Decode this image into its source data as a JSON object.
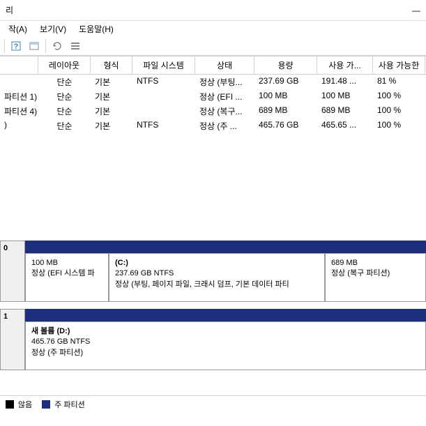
{
  "window": {
    "title": "리"
  },
  "menu": {
    "action": "작(A)",
    "view": "보기(V)",
    "help": "도움말(H)"
  },
  "columns": {
    "name": "",
    "layout": "레이아웃",
    "type": "형식",
    "fs": "파일 시스템",
    "state": "상태",
    "capacity": "용량",
    "used": "사용 가...",
    "free": "사용 가능한"
  },
  "rows": [
    {
      "name": "",
      "layout": "단순",
      "type": "기본",
      "fs": "NTFS",
      "state": "정상 (부팅...",
      "cap": "237.69 GB",
      "used": "191.48 ...",
      "free": "81 %"
    },
    {
      "name": "파티션 1)",
      "layout": "단순",
      "type": "기본",
      "fs": "",
      "state": "정상 (EFI ...",
      "cap": "100 MB",
      "used": "100 MB",
      "free": "100 %"
    },
    {
      "name": "파티션 4)",
      "layout": "단순",
      "type": "기본",
      "fs": "",
      "state": "정상 (복구...",
      "cap": "689 MB",
      "used": "689 MB",
      "free": "100 %"
    },
    {
      "name": ")",
      "layout": "단순",
      "type": "기본",
      "fs": "NTFS",
      "state": "정상 (주 ...",
      "cap": "465.76 GB",
      "used": "465.65 ...",
      "free": "100 %"
    }
  ],
  "disk0": {
    "label": "0",
    "p1": {
      "size": "100 MB",
      "desc": "정상 (EFI 시스템 파"
    },
    "p2": {
      "name": "(C:)",
      "size": "237.69 GB NTFS",
      "desc": "정상 (부팅, 페이지 파일, 크래시 덤프, 기본 데이터 파티"
    },
    "p3": {
      "size": "689 MB",
      "desc": "정상 (복구 파티션)"
    }
  },
  "disk1": {
    "label": "1",
    "p1": {
      "name": "새 볼륨  (D:)",
      "size": "465.76 GB NTFS",
      "desc": "정상 (주 파티션)"
    }
  },
  "legend": {
    "unallocated": "않음",
    "primary": "주 파티션"
  }
}
